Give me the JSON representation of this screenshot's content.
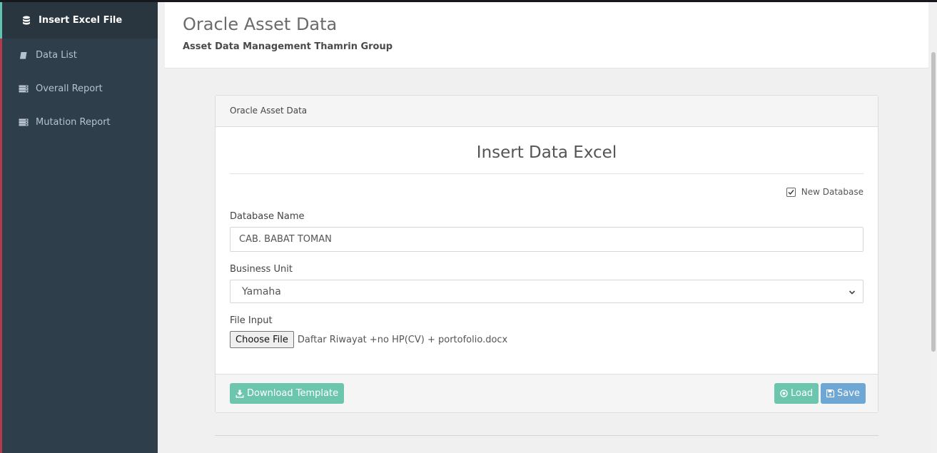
{
  "sidebar": {
    "items": [
      {
        "label": "Insert Excel File",
        "icon": "database-icon"
      },
      {
        "label": "Data List",
        "icon": "book-icon"
      },
      {
        "label": "Overall Report",
        "icon": "server-icon"
      },
      {
        "label": "Mutation Report",
        "icon": "server-icon"
      }
    ]
  },
  "header": {
    "title": "Oracle Asset Data",
    "subtitle": "Asset Data Management Thamrin Group"
  },
  "panel": {
    "heading": "Oracle Asset Data",
    "form_title": "Insert Data Excel",
    "new_database": {
      "label": "New Database",
      "checked": true
    },
    "database_name": {
      "label": "Database Name",
      "value": "CAB. BABAT TOMAN"
    },
    "business_unit": {
      "label": "Business Unit",
      "selected": "Yamaha"
    },
    "file_input": {
      "label": "File Input",
      "button": "Choose File",
      "file_name": "Daftar Riwayat +no HP(CV) + portofolio.docx"
    },
    "footer": {
      "download_label": "Download Template",
      "load_label": "Load",
      "save_label": "Save"
    }
  },
  "colors": {
    "sidebar_bg": "#2e3e4b",
    "accent_teal": "#6cc5ad",
    "accent_blue": "#6fa7d4"
  }
}
